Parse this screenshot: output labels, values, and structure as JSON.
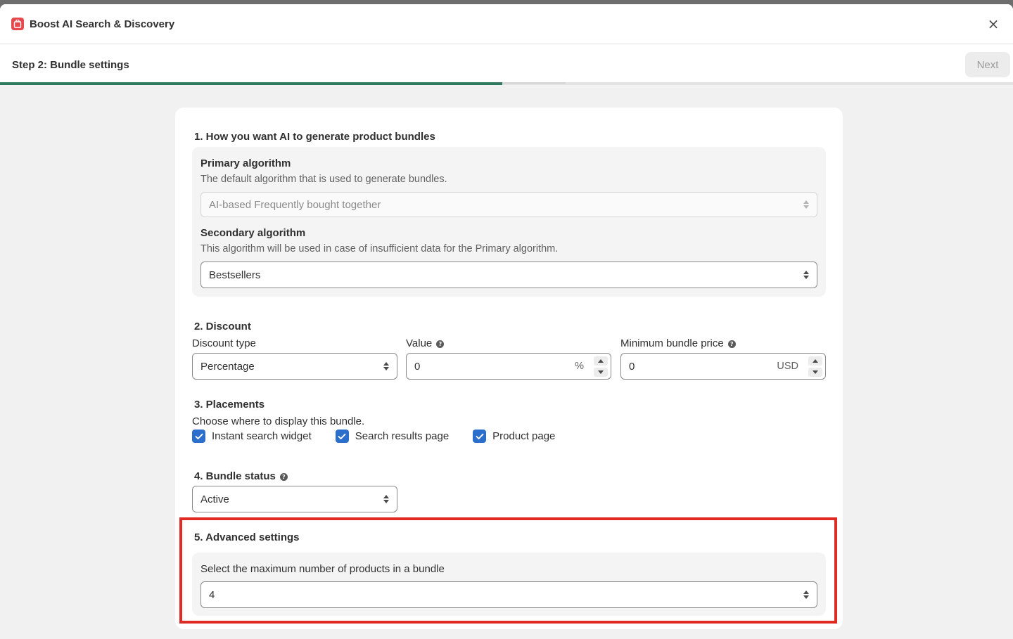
{
  "app": {
    "title": "Boost AI Search & Discovery",
    "close_label": "×"
  },
  "step": {
    "title": "Step 2: Bundle settings",
    "next_label": "Next",
    "progress_percent": 49.6
  },
  "section1": {
    "title": "1. How you want AI to generate product bundles",
    "primary": {
      "label": "Primary algorithm",
      "help": "The default algorithm that is used to generate bundles.",
      "value": "AI-based Frequently bought together"
    },
    "secondary": {
      "label": "Secondary algorithm",
      "help": "This algorithm will be used in case of insufficient data for the Primary algorithm.",
      "value": "Bestsellers"
    }
  },
  "section2": {
    "title": "2. Discount",
    "discount_type": {
      "label": "Discount type",
      "value": "Percentage"
    },
    "value": {
      "label": "Value",
      "value": "0",
      "suffix": "%"
    },
    "min_price": {
      "label": "Minimum bundle price",
      "value": "0",
      "suffix": "USD"
    }
  },
  "section3": {
    "title": "3. Placements",
    "help": "Choose where to display this bundle.",
    "options": [
      {
        "label": "Instant search widget",
        "checked": true
      },
      {
        "label": "Search results page",
        "checked": true
      },
      {
        "label": "Product page",
        "checked": true
      }
    ]
  },
  "section4": {
    "title": "4. Bundle status",
    "value": "Active"
  },
  "section5": {
    "title": "5. Advanced settings",
    "max_products": {
      "label": "Select the maximum number of products in a bundle",
      "value": "4"
    }
  },
  "colors": {
    "accent": "#2c6ecb",
    "progress": "#2e7a5e",
    "highlight": "#e02b24",
    "logo": "#e5484d"
  }
}
